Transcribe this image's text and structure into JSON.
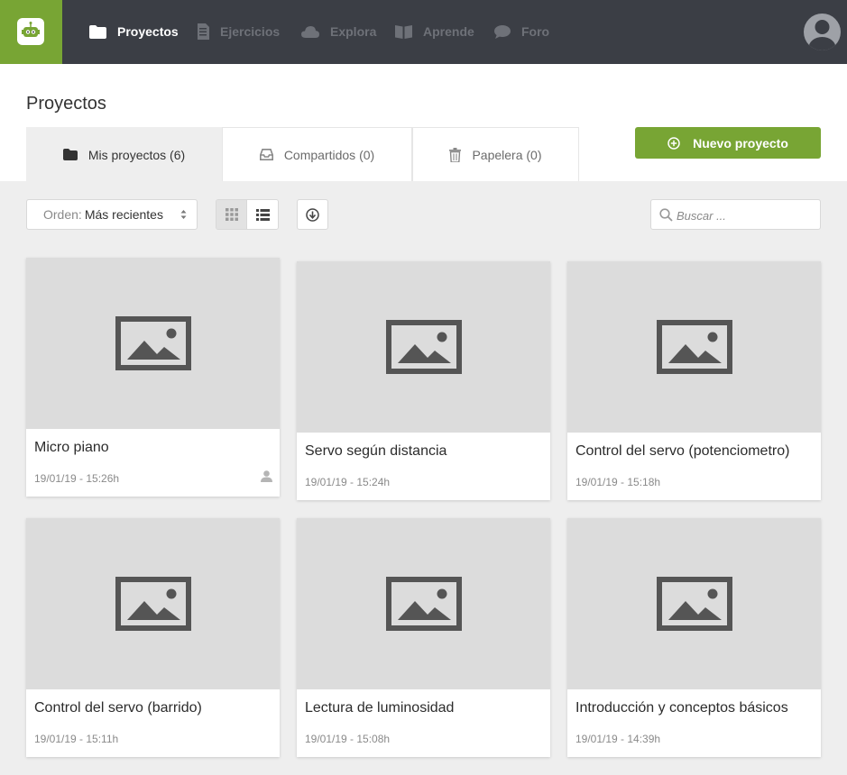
{
  "nav": {
    "items": [
      {
        "label": "Proyectos",
        "icon": "folder-icon",
        "active": true
      },
      {
        "label": "Ejercicios",
        "icon": "document-icon",
        "active": false
      },
      {
        "label": "Explora",
        "icon": "cloud-icon",
        "active": false
      },
      {
        "label": "Aprende",
        "icon": "book-icon",
        "active": false
      },
      {
        "label": "Foro",
        "icon": "chat-icon",
        "active": false
      }
    ]
  },
  "page": {
    "title": "Proyectos"
  },
  "tabs": [
    {
      "label": "Mis proyectos (6)",
      "icon": "folder-icon",
      "active": true
    },
    {
      "label": "Compartidos (0)",
      "icon": "inbox-icon",
      "active": false
    },
    {
      "label": "Papelera (0)",
      "icon": "trash-icon",
      "active": false
    }
  ],
  "new_project": {
    "label": "Nuevo proyecto",
    "icon": "plus-circle-icon"
  },
  "toolbar": {
    "order_label": "Orden:",
    "order_value": "Más recientes",
    "search_placeholder": "Buscar ..."
  },
  "projects": [
    {
      "title": "Micro piano",
      "date": "19/01/19 - 15:26h",
      "owner_icon": "user-icon"
    },
    {
      "title": "Servo según distancia",
      "date": "19/01/19 - 15:24h"
    },
    {
      "title": "Control del servo (potenciometro)",
      "date": "19/01/19 - 15:18h"
    },
    {
      "title": "Control del servo (barrido)",
      "date": "19/01/19 - 15:11h"
    },
    {
      "title": "Lectura de luminosidad",
      "date": "19/01/19 - 15:08h"
    },
    {
      "title": "Introducción y conceptos básicos",
      "date": "19/01/19 - 14:39h"
    }
  ],
  "colors": {
    "brand_green": "#78a534",
    "topbar": "#3b3e45",
    "background": "#eeeeee",
    "thumb": "#dcdcdc"
  }
}
